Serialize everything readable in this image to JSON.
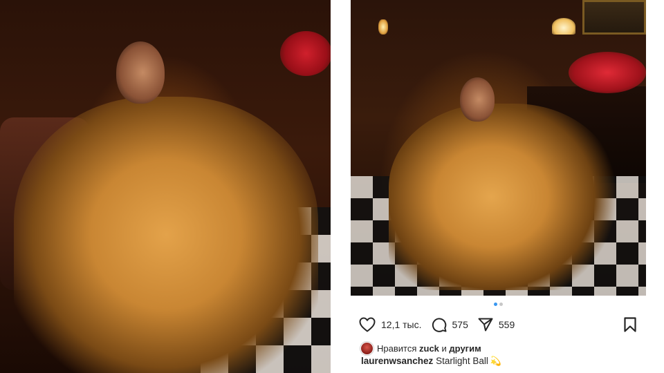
{
  "post": {
    "likes_count": "12,1 тыс.",
    "comments_count": "575",
    "shares_count": "559",
    "liked_by_prefix": "Нравится",
    "liked_by_user": "zuck",
    "liked_by_conj": "и",
    "liked_by_others": "другим",
    "author": "laurenwsanchez",
    "caption": "Starlight Ball",
    "caption_emoji": "💫",
    "carousel": {
      "total": 2,
      "active": 1
    }
  },
  "icons": {
    "like": "heart-icon",
    "comment": "comment-bubble-icon",
    "share": "paper-plane-icon",
    "save": "bookmark-icon",
    "caption_emoji": "dizzy-star-emoji"
  },
  "colors": {
    "carousel_active": "#3897f0",
    "carousel_inactive": "#c7c7c7",
    "text": "#262626"
  }
}
